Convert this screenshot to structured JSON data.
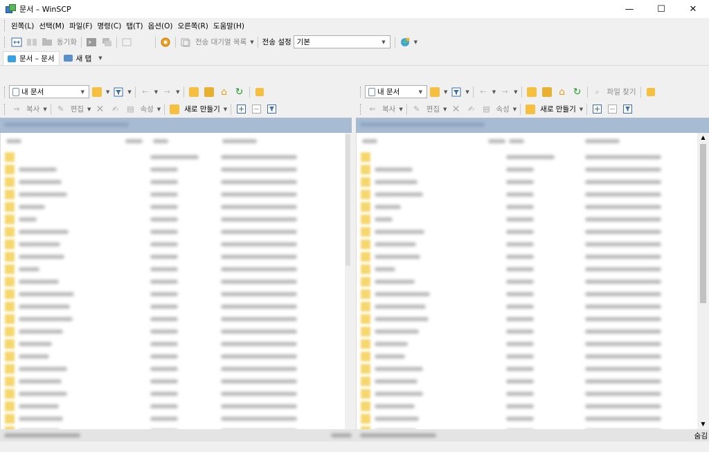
{
  "window": {
    "title": "문서 – WinSCP",
    "controls": {
      "minimize": "—",
      "maximize": "☐",
      "close": "✕"
    }
  },
  "menu": {
    "items": [
      "왼쪽(L)",
      "선택(M)",
      "파일(F)",
      "명령(C)",
      "탭(T)",
      "옵션(O)",
      "오른쪽(R)",
      "도움말(H)"
    ]
  },
  "toolbar": {
    "sync_label": "동기화",
    "queue_label": "전송 대기열 목록",
    "transfer_settings_label": "전송 설정",
    "transfer_settings_value": "기본"
  },
  "tabs": [
    {
      "label": "문서 – 문서",
      "active": true
    },
    {
      "label": "새 탭",
      "active": false
    }
  ],
  "left_pane": {
    "location": "내 문서",
    "actions": {
      "copy": "복사",
      "edit": "편집",
      "properties": "속성",
      "new": "새로 만들기"
    }
  },
  "right_pane": {
    "location": "내 문서",
    "find_files": "파일 찾기",
    "actions": {
      "copy": "복사",
      "edit": "편집",
      "properties": "속성",
      "new": "새로 만들기"
    }
  },
  "status": {
    "right_end": "숨김"
  },
  "colors": {
    "address_bar": "#a7bbd2",
    "folder": "#f5d76e",
    "accent_blue": "#3a7bd5"
  }
}
